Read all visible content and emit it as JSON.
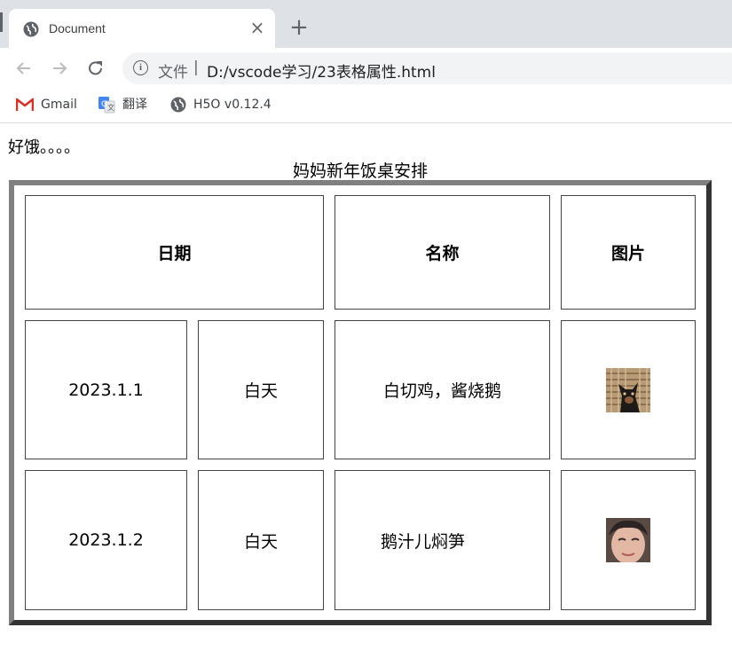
{
  "browser": {
    "tab_title": "Document",
    "address_scheme": "文件",
    "address_separator": "|",
    "address_url": "D:/vscode学习/23表格属性.html",
    "bookmarks": [
      {
        "label": "Gmail",
        "icon": "gmail-icon"
      },
      {
        "label": "翻译",
        "icon": "translate-icon"
      },
      {
        "label": "H5O v0.12.4",
        "icon": "globe-icon"
      }
    ]
  },
  "page": {
    "intro_text": "好饿。。。。",
    "table": {
      "caption": "妈妈新年饭桌安排",
      "headers": {
        "date": "日期",
        "name": "名称",
        "picture": "图片"
      },
      "rows": [
        {
          "date": "2023.1.1",
          "time": "白天",
          "name": "白切鸡，酱烧鹅",
          "picture": "dog-photo"
        },
        {
          "date": "2023.1.2",
          "time": "白天",
          "name": "鹅汁儿焖笋",
          "picture": "person-photo"
        }
      ]
    }
  }
}
